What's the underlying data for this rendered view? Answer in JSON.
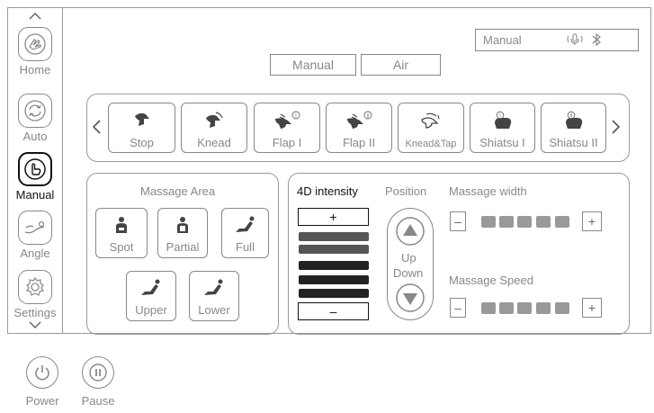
{
  "sidebar": {
    "items": [
      {
        "label": "Home",
        "icon": "hand-icon",
        "active": false
      },
      {
        "label": "Auto",
        "icon": "refresh-icon",
        "active": false
      },
      {
        "label": "Manual",
        "icon": "pointing-hand-icon",
        "active": true
      },
      {
        "label": "Angle",
        "icon": "recline-icon",
        "active": false
      },
      {
        "label": "Settings",
        "icon": "gear-icon",
        "active": false
      }
    ]
  },
  "top": {
    "manual_tab": "Manual",
    "air_tab": "Air"
  },
  "status": {
    "mode": "Manual",
    "icons": [
      "voice-icon",
      "bluetooth-icon"
    ]
  },
  "modes": [
    {
      "label": "Stop"
    },
    {
      "label": "Knead"
    },
    {
      "label": "Flap I",
      "badge": "I"
    },
    {
      "label": "Flap II",
      "badge": "II"
    },
    {
      "label": "Knead&Tap"
    },
    {
      "label": "Shiatsu I",
      "badge": "I"
    },
    {
      "label": "Shiatsu II",
      "badge": "II"
    }
  ],
  "massage_area": {
    "title": "Massage Area",
    "buttons": [
      "Spot",
      "Partial",
      "Full",
      "Upper",
      "Lower"
    ]
  },
  "intensity": {
    "title": "4D intensity",
    "plus": "+",
    "minus": "–",
    "levels": 6,
    "active_levels": 4
  },
  "position": {
    "title": "Position",
    "up_label": "Up",
    "down_label": "Down"
  },
  "width": {
    "title": "Massage width",
    "minus": "–",
    "plus": "+",
    "segments": 5
  },
  "speed": {
    "title": "Massage Speed",
    "minus": "–",
    "plus": "+",
    "segments": 5
  },
  "bottom": {
    "power": "Power",
    "pause": "Pause"
  },
  "colors": {
    "border": "#888888",
    "active": "#111111",
    "segment": "#999999",
    "bar_dark": "#222222",
    "bar_mid": "#555555"
  }
}
